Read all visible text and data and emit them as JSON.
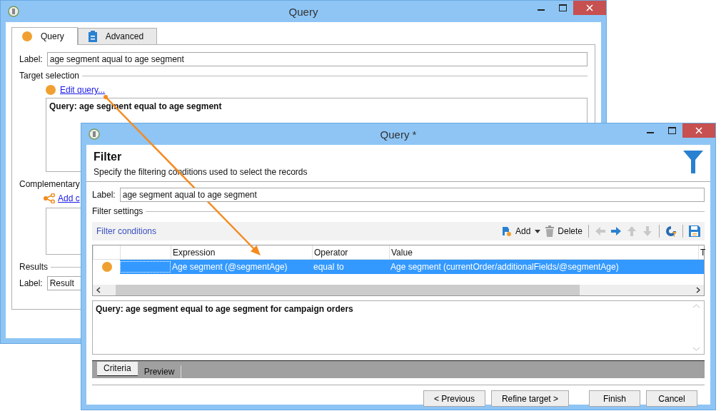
{
  "back_window": {
    "title": "Query",
    "tabs": [
      {
        "label": "Query",
        "selected": true
      },
      {
        "label": "Advanced",
        "selected": false
      }
    ],
    "label_caption": "Label:",
    "label_value": "age segment aqual to age segment",
    "target_section": "Target selection",
    "edit_link": "Edit query...",
    "query_summary": "Query: age segment equal to age segment",
    "complementary_section": "Complementary",
    "add_link": "Add c",
    "results_section": "Results",
    "results_label_caption": "Label:",
    "results_label_value": "Result"
  },
  "front_window": {
    "title": "Query *",
    "heading": "Filter",
    "description": "Specify the filtering conditions used to select the records",
    "label_caption": "Label:",
    "label_value": "age segment aqual to age segment",
    "settings_section": "Filter settings",
    "conditions_title": "Filter conditions",
    "toolbar": [
      {
        "kind": "add",
        "label": "Add"
      },
      {
        "kind": "delete",
        "label": "Delete"
      },
      {
        "kind": "left",
        "disabled": true
      },
      {
        "kind": "right",
        "disabled": false
      },
      {
        "kind": "up",
        "disabled": true
      },
      {
        "kind": "down",
        "disabled": true
      },
      {
        "kind": "refresh"
      },
      {
        "kind": "save"
      }
    ],
    "columns": [
      "Expression",
      "Operator",
      "Value",
      "T"
    ],
    "rows": [
      {
        "selected": true,
        "expression": "Age segment (@segmentAge)",
        "operator": "equal to",
        "value": "Age segment (currentOrder/additionalFields/@segmentAge)"
      }
    ],
    "query_summary": "Query: age segment equal to age segment for campaign orders",
    "tabs": [
      {
        "label": "Criteria",
        "selected": true
      },
      {
        "label": "Preview",
        "selected": false
      }
    ],
    "buttons": [
      "< Previous",
      "Refine target >",
      "Finish",
      "Cancel"
    ]
  }
}
